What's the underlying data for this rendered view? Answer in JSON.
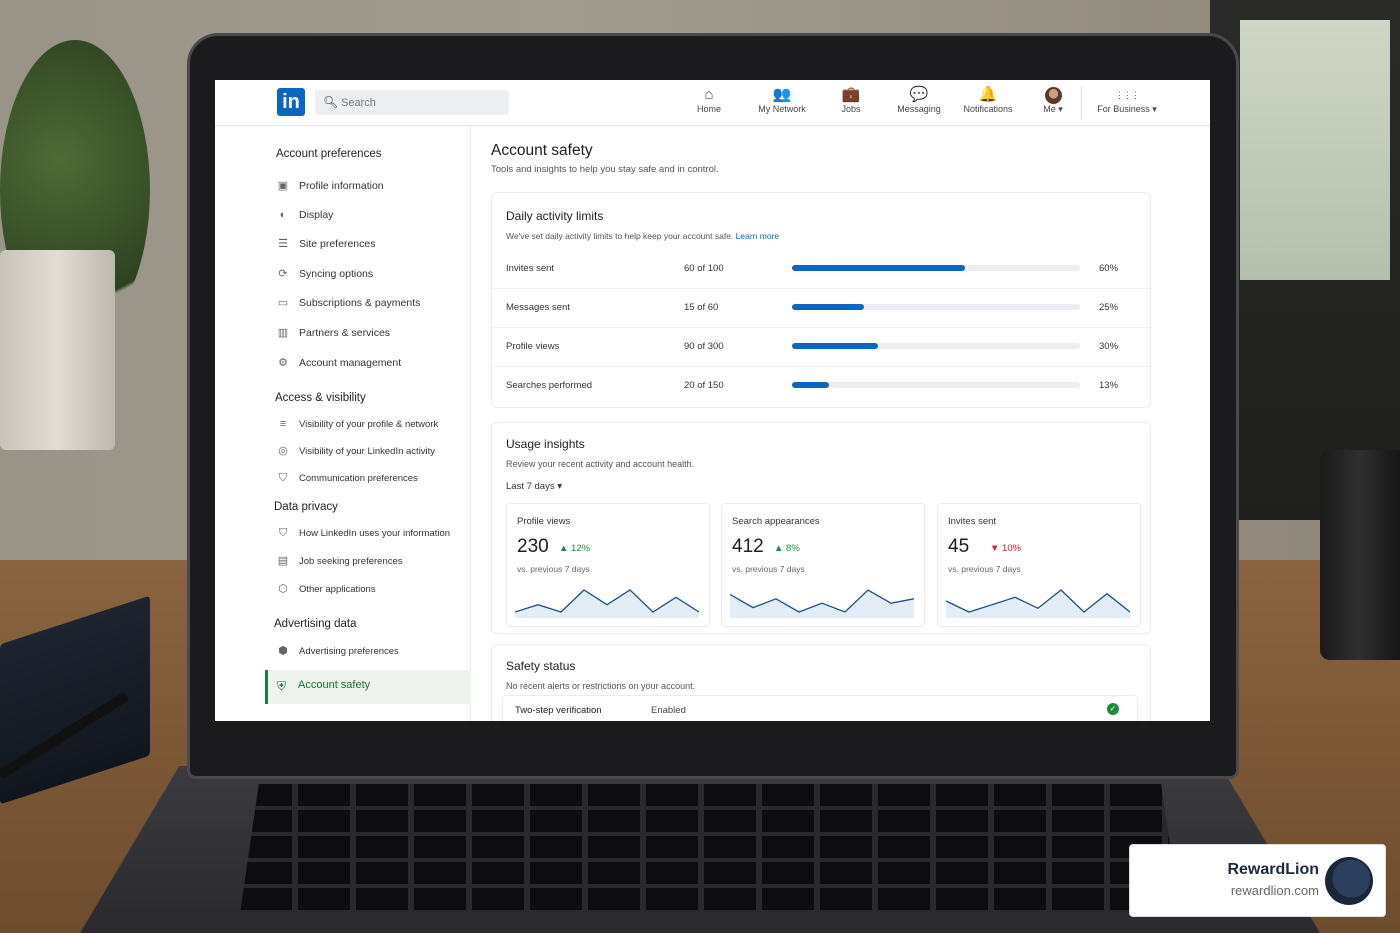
{
  "topbar": {
    "logo": "in",
    "search_placeholder": "Search",
    "nav": [
      {
        "label": "Home",
        "icon": "home-icon",
        "glyph": "⌂"
      },
      {
        "label": "My Network",
        "icon": "network-icon",
        "glyph": "👥"
      },
      {
        "label": "Jobs",
        "icon": "briefcase-icon",
        "glyph": "💼"
      },
      {
        "label": "Messaging",
        "icon": "message-icon",
        "glyph": "💬"
      },
      {
        "label": "Notifications",
        "icon": "bell-icon",
        "glyph": "🔔"
      },
      {
        "label": "Me ▾",
        "icon": "avatar"
      },
      {
        "label": "For Business ▾",
        "icon": "grid-icon",
        "glyph": "⋮⋮⋮"
      }
    ]
  },
  "sidebar": {
    "account_preferences": {
      "title": "Account preferences",
      "items": [
        "Profile information",
        "Display",
        "Site preferences",
        "Syncing options",
        "Subscriptions & payments",
        "Partners & services",
        "Account management"
      ]
    },
    "access_visibility": {
      "title": "Access & visibility",
      "items": [
        "Visibility of your profile & network",
        "Visibility of your LinkedIn activity",
        "Communication preferences"
      ]
    },
    "data_privacy": {
      "title": "Data privacy",
      "items": [
        "How LinkedIn uses your information",
        "Job seeking preferences",
        "Other applications"
      ]
    },
    "advertising_data": {
      "title": "Advertising data",
      "items": [
        "Advertising preferences"
      ]
    },
    "active": "Account safety"
  },
  "main": {
    "title": "Account safety",
    "subtitle": "Tools and insights to help you stay safe and in control.",
    "limits": {
      "title": "Daily activity limits",
      "desc": "We've set daily activity limits to help keep your account safe.",
      "learn_more": "Learn more",
      "rows": [
        {
          "label": "Invites sent",
          "count": "60 of 100",
          "pct_label": "60%",
          "pct": 60
        },
        {
          "label": "Messages sent",
          "count": "15 of 60",
          "pct_label": "25%",
          "pct": 25
        },
        {
          "label": "Profile views",
          "count": "90 of 300",
          "pct_label": "30%",
          "pct": 30
        },
        {
          "label": "Searches performed",
          "count": "20 of 150",
          "pct_label": "13%",
          "pct": 13
        }
      ]
    },
    "insights": {
      "title": "Usage insights",
      "desc": "Review your recent activity and account health.",
      "range": "Last 7 days ▾",
      "stats": [
        {
          "title": "Profile views",
          "value": "230",
          "delta": "▲ 12%",
          "direction": "up",
          "compare": "vs. previous 7 days",
          "trend": [
            3,
            4,
            3,
            6,
            4,
            6,
            3,
            5,
            3
          ]
        },
        {
          "title": "Search appearances",
          "value": "412",
          "delta": "▲ 8%",
          "direction": "up",
          "compare": "vs. previous 7 days",
          "trend": [
            6,
            3,
            5,
            2,
            4,
            2,
            7,
            4,
            5
          ]
        },
        {
          "title": "Invites sent",
          "value": "45",
          "delta": "▼ 10%",
          "direction": "down",
          "compare": "vs. previous 7 days",
          "trend": [
            5,
            2,
            4,
            6,
            3,
            8,
            2,
            7,
            2
          ]
        }
      ]
    },
    "safety": {
      "title": "Safety status",
      "desc": "No recent alerts or restrictions on your account.",
      "row_label": "Two-step verification",
      "row_value": "Enabled"
    }
  },
  "watermark": {
    "brand": "RewardLion",
    "url": "rewardlion.com"
  },
  "colors": {
    "brand": "#0a66c2",
    "success": "#1d8a3f",
    "danger": "#cc1f1f"
  }
}
